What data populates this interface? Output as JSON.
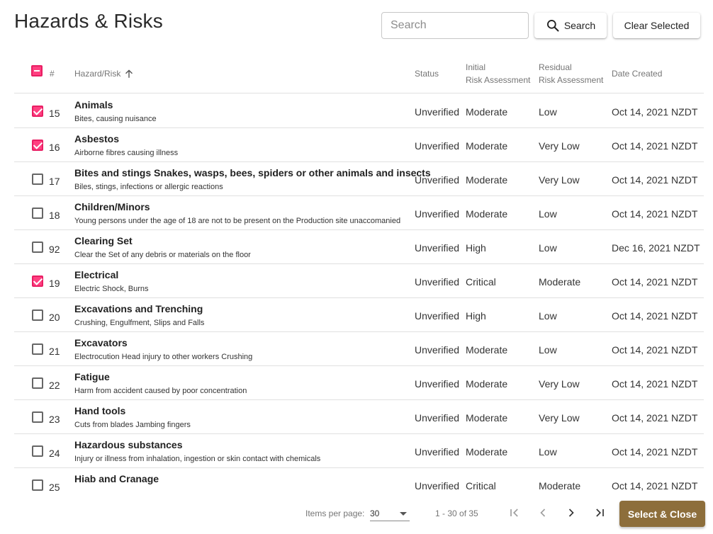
{
  "page": {
    "title": "Hazards & Risks"
  },
  "search": {
    "placeholder": "Search",
    "button_label": "Search"
  },
  "toolbar": {
    "clear_label": "Clear Selected"
  },
  "columns": {
    "num": "#",
    "hazard": "Hazard/Risk",
    "status": "Status",
    "initial_line1": "Initial",
    "initial_line2": "Risk Assessment",
    "residual_line1": "Residual",
    "residual_line2": "Risk Assessment",
    "date": "Date Created"
  },
  "header_checkbox": "indeterminate",
  "rows": [
    {
      "checked": true,
      "num": "15",
      "name": "Animals",
      "desc": "Bites, causing nuisance",
      "status": "Unverified",
      "initial": "Moderate",
      "residual": "Low",
      "date": "Oct 14, 2021 NZDT"
    },
    {
      "checked": true,
      "num": "16",
      "name": "Asbestos",
      "desc": "Airborne fibres causing illness",
      "status": "Unverified",
      "initial": "Moderate",
      "residual": "Very Low",
      "date": "Oct 14, 2021 NZDT"
    },
    {
      "checked": false,
      "num": "17",
      "name": "Bites and stings Snakes, wasps, bees, spiders or other animals and insects",
      "desc": "Biles, stings, infections or allergic reactions",
      "status": "Unverified",
      "initial": "Moderate",
      "residual": "Very Low",
      "date": "Oct 14, 2021 NZDT"
    },
    {
      "checked": false,
      "num": "18",
      "name": "Children/Minors",
      "desc": "Young persons under the age of 18 are not to be present on the Production site unaccomanied",
      "status": "Unverified",
      "initial": "Moderate",
      "residual": "Low",
      "date": "Oct 14, 2021 NZDT"
    },
    {
      "checked": false,
      "num": "92",
      "name": "Clearing Set",
      "desc": "Clear the Set of any debris or materials on the floor",
      "status": "Unverified",
      "initial": "High",
      "residual": "Low",
      "date": "Dec 16, 2021 NZDT"
    },
    {
      "checked": true,
      "num": "19",
      "name": "Electrical",
      "desc": "Electric Shock, Burns",
      "status": "Unverified",
      "initial": "Critical",
      "residual": "Moderate",
      "date": "Oct 14, 2021 NZDT"
    },
    {
      "checked": false,
      "num": "20",
      "name": "Excavations and Trenching",
      "desc": "Crushing, Engulfment, Slips and Falls",
      "status": "Unverified",
      "initial": "High",
      "residual": "Low",
      "date": "Oct 14, 2021 NZDT"
    },
    {
      "checked": false,
      "num": "21",
      "name": "Excavators",
      "desc": "Electrocution Head injury to other workers Crushing",
      "status": "Unverified",
      "initial": "Moderate",
      "residual": "Low",
      "date": "Oct 14, 2021 NZDT"
    },
    {
      "checked": false,
      "num": "22",
      "name": "Fatigue",
      "desc": "Harm from accident caused by poor concentration",
      "status": "Unverified",
      "initial": "Moderate",
      "residual": "Very Low",
      "date": "Oct 14, 2021 NZDT"
    },
    {
      "checked": false,
      "num": "23",
      "name": "Hand tools",
      "desc": "Cuts from blades Jambing fingers",
      "status": "Unverified",
      "initial": "Moderate",
      "residual": "Very Low",
      "date": "Oct 14, 2021 NZDT"
    },
    {
      "checked": false,
      "num": "24",
      "name": "Hazardous substances",
      "desc": "Injury or illness from inhalation, ingestion or skin contact with chemicals",
      "status": "Unverified",
      "initial": "Moderate",
      "residual": "Low",
      "date": "Oct 14, 2021 NZDT"
    },
    {
      "checked": false,
      "num": "25",
      "name": "Hiab and Cranage",
      "desc": "",
      "status": "Unverified",
      "initial": "Critical",
      "residual": "Moderate",
      "date": "Oct 14, 2021 NZDT"
    }
  ],
  "paginator": {
    "items_per_page_label": "Items per page:",
    "items_per_page": "30",
    "range": "1 - 30 of 35"
  },
  "actions": {
    "select_close_label": "Select & Close"
  },
  "colors": {
    "accent": "#ff4081",
    "primary_button": "#8d6e3b"
  },
  "icons": {
    "search": "search-icon",
    "sort": "arrow-up-icon",
    "first": "first-page-icon",
    "prev": "chevron-left-icon",
    "next": "chevron-right-icon",
    "last": "last-page-icon"
  }
}
